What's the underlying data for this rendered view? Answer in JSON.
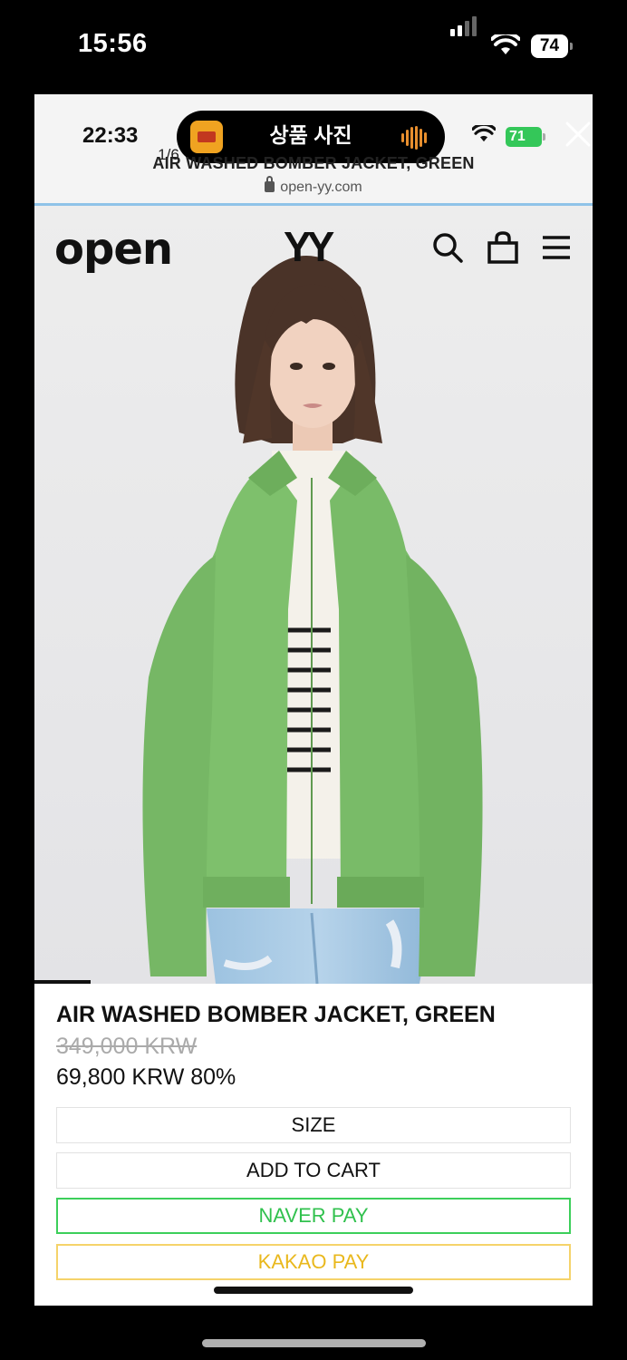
{
  "outer_status": {
    "time": "15:56",
    "battery": "74"
  },
  "viewer": {
    "inner_time": "22:33",
    "title": "상품 사진",
    "counter": "1/6",
    "inner_battery": "71"
  },
  "browser": {
    "page_title": "AIR WASHED BOMBER JACKET, GREEN",
    "url": "open-yy.com"
  },
  "site_header": {
    "logo_left": "open",
    "logo_right": "YY"
  },
  "product": {
    "name": "AIR WASHED BOMBER JACKET, GREEN",
    "original_price": "349,000 KRW",
    "sale_price": "69,800 KRW 80%",
    "buttons": {
      "size": "SIZE",
      "add_to_cart": "ADD TO CART",
      "naver_pay": "NAVER PAY",
      "kakao_pay": "KAKAO PAY"
    }
  },
  "colors": {
    "naver": "#3ccf5a",
    "kakao": "#f5d36a",
    "jacket": "#7fbf6c"
  }
}
